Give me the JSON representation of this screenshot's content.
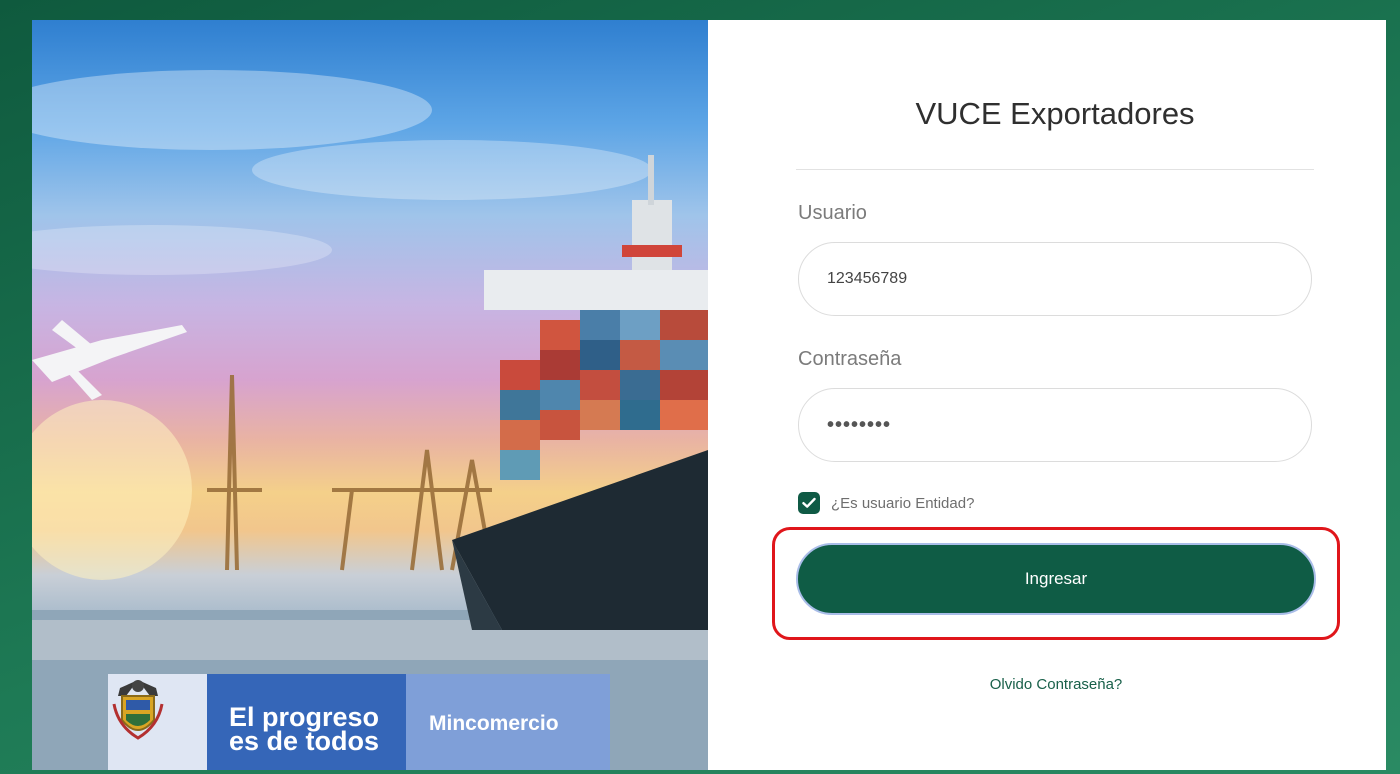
{
  "login": {
    "title": "VUCE Exportadores",
    "username_label": "Usuario",
    "username_value": "123456789",
    "password_label": "Contraseña",
    "password_value": "••••••••",
    "entity_checkbox_label": "¿Es usuario Entidad?",
    "entity_checkbox_checked": true,
    "submit_label": "Ingresar",
    "forgot_password_label": "Olvido Contraseña?"
  },
  "brand": {
    "slogan_line1": "El progreso",
    "slogan_line2": "es de todos",
    "ministry": "Mincomercio"
  },
  "colors": {
    "primary": "#0f5c45",
    "highlight": "#e0161b",
    "brand_blue": "#3566b8",
    "brand_light_blue": "#7f9fd8"
  }
}
